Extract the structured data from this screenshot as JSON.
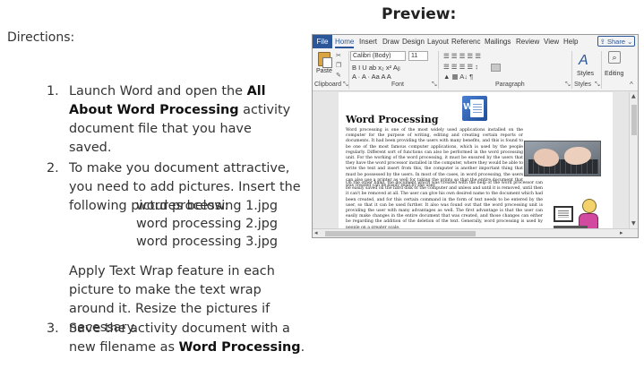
{
  "directions": {
    "heading": "Directions:",
    "step1": {
      "number": "1.",
      "text_before": "Launch Word and open the ",
      "bold": "All About Word Processing",
      "text_after": " activity document file that you have saved."
    },
    "step2": {
      "number": "2.",
      "text": "To make you document attractive, you need to add pictures. Insert the following pictures below:",
      "files": [
        "word processing 1.jpg",
        "word processing 2.jpg",
        "word processing 3.jpg"
      ],
      "apply_text": "Apply Text Wrap feature in each picture to make the text wrap around it. Resize the pictures if necessary."
    },
    "step3": {
      "number": "3.",
      "text_before": "Save the activity document with a new filename as ",
      "bold": "Word Processing",
      "text_after": "."
    }
  },
  "preview": {
    "label": "Preview:",
    "tabs": {
      "file": "File",
      "home": "Home",
      "insert": "Insert",
      "draw": "Draw",
      "design": "Design",
      "layout": "Layout",
      "references": "Referenc",
      "mailings": "Mailings",
      "review": "Review",
      "view": "View",
      "help": "Help"
    },
    "share_label": "Share",
    "ribbon": {
      "paste_label": "Paste",
      "font_name": "Calibri (Body)",
      "font_size": "11",
      "format_row1": "B  I  U  ab  x₂  x²  Aᵦ",
      "format_row2": "A  ·  A  ·  Aa  A  A",
      "para_row1": "☰  ☰  ☰  ☰  ☰",
      "para_row2": "☰  ☰  ☰  ☰  ↕",
      "para_row3": "▲  ▦  A↓  ¶",
      "styles_label": "Styles",
      "editing_label": "Editing",
      "groups": {
        "clipboard": "Clipboard",
        "font": "Font",
        "paragraph": "Paragraph",
        "styles": "Styles"
      }
    },
    "document": {
      "title": "Word Processing",
      "para1": "Word processing is one of the most widely used applications installed on the computer for the purpose of writing, editing and creating certain reports or documents. It had been providing the users with many benefits, and this is found to be one of the most famous computer applications, which is used by the people regularly.  Different sort of functions can also be performed in the word processing unit. For the working of the word processing, it must be ensured by the users that they have the word processor installed in the computer, where they would be able to write the text and insert from this, the computer is another important thing that must be possessed by the users. In most of the cases, in word processing, the users can also use a printer as well for taking the prints so that the entire document that was  created can be easily read by the user.",
      "para2": "On the other hand, the document which was  created with the help of the word processor can be easily saved on the hard disk of the computer and unless and until it is removed, until then it can't be removed at all. The user can give his own desired name to the document which had been created, and for this certain command in the form of text needs to be entered by the user, so that it can be used further. It also was found out that the word processing unit is providing the user with many advantages as well. The first advantage is that the user can easily make changes in the entire document that was  created, and those changes can either be regarding the addition of the deletion of the text. Generally, word processing is used by people on a greater scale."
    }
  }
}
